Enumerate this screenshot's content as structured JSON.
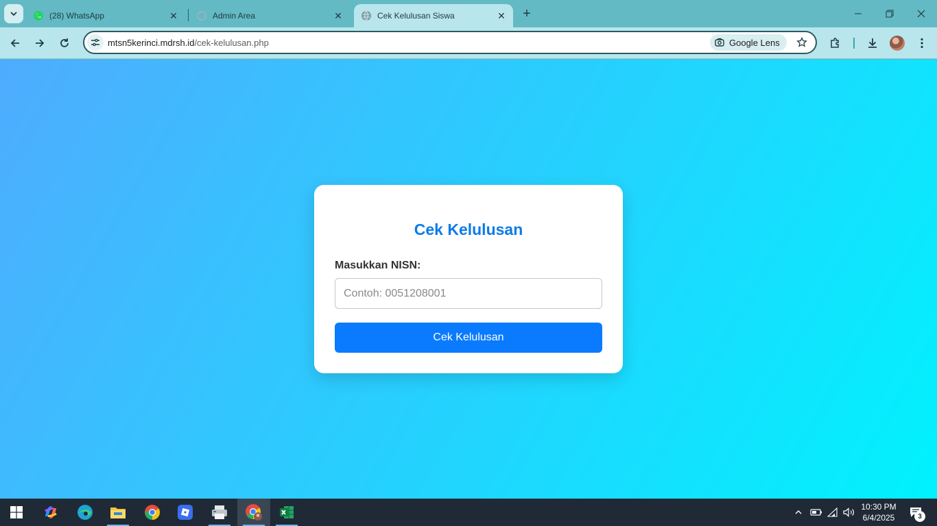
{
  "browser": {
    "tabs": [
      {
        "title": "(28) WhatsApp",
        "icon": "whatsapp-icon"
      },
      {
        "title": "Admin Area",
        "icon": "loading-icon"
      },
      {
        "title": "Cek Kelulusan Siswa",
        "icon": "globe-icon",
        "active": true
      }
    ],
    "omnibox": {
      "url_host": "mtsn5kerinci.mdrsh.id",
      "url_path": "/cek-kelulusan.php",
      "lens_label": "Google Lens"
    }
  },
  "page": {
    "heading": "Cek Kelulusan",
    "nisn_label": "Masukkan NISN:",
    "nisn_placeholder": "Contoh: 0051208001",
    "nisn_value": "",
    "submit_label": "Cek Kelulusan",
    "colors": {
      "accent": "#0a7bff",
      "gradient_start": "#4facfe",
      "gradient_end": "#00f2fe"
    }
  },
  "taskbar": {
    "apps": [
      "start-icon",
      "copilot-icon",
      "edge-icon",
      "file-explorer-icon",
      "chrome-icon",
      "roblox-icon",
      "printer-app-icon",
      "chrome-profile-icon",
      "excel-icon"
    ],
    "clock_time": "10:30 PM",
    "clock_date": "6/4/2025",
    "notification_count": "3"
  }
}
